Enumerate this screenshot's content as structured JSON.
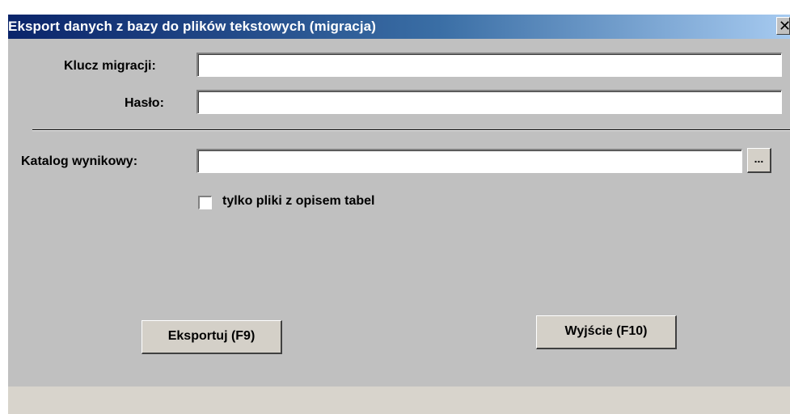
{
  "window": {
    "title": "Eksport danych z bazy do plików tekstowych (migracja)",
    "close_glyph": "✕"
  },
  "form": {
    "migration_key": {
      "label": "Klucz migracji:",
      "value": "",
      "placeholder": ""
    },
    "password": {
      "label": "Hasło:",
      "value": "",
      "placeholder": ""
    },
    "output_dir": {
      "label": "Katalog wynikowy:",
      "value": "",
      "placeholder": "",
      "browse_label": "..."
    },
    "only_table_description": {
      "label": "tylko pliki z opisem tabel",
      "checked": false
    }
  },
  "buttons": {
    "export_label": "Eksportuj (F9)",
    "exit_label": "Wyjście (F10)"
  },
  "colors": {
    "dialog_bg": "#c0c0c0",
    "titlebar_start": "#0a246a",
    "titlebar_end": "#a6caf0",
    "button_face": "#d4d0c8",
    "statusbar_bg": "#d8d4cc"
  },
  "icons": {
    "close": "close-icon",
    "browse": "ellipsis-icon"
  }
}
